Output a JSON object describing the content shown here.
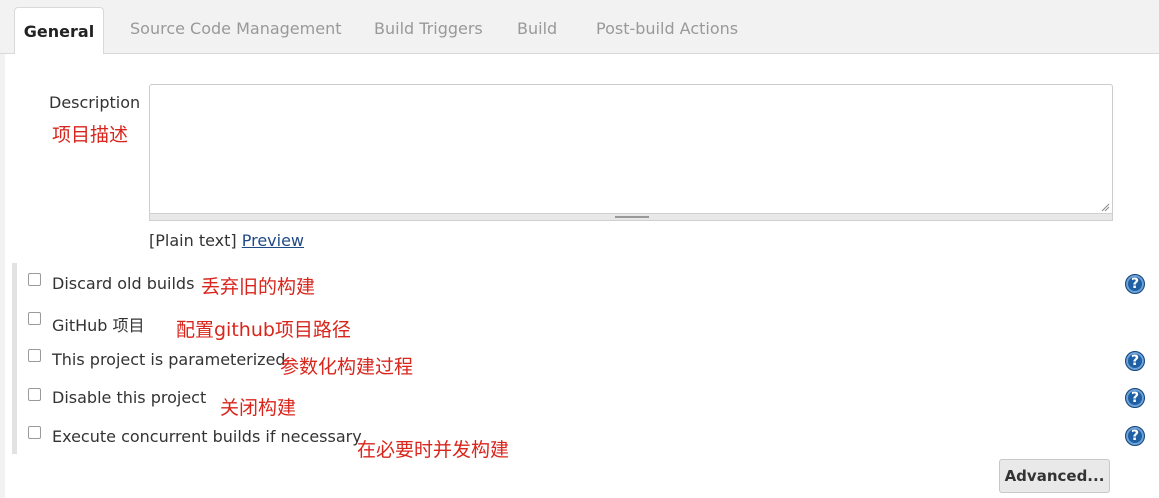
{
  "tabs": [
    {
      "label": "General",
      "active": true
    },
    {
      "label": "Source Code Management"
    },
    {
      "label": "Build Triggers"
    },
    {
      "label": "Build"
    },
    {
      "label": "Post-build Actions"
    }
  ],
  "description": {
    "label": "Description",
    "annotation": "项目描述",
    "value": "",
    "format_text": "[Plain text]",
    "preview_link": "Preview"
  },
  "options": [
    {
      "label": "Discard old builds",
      "annotation": "丢弃旧的构建",
      "checked": false,
      "help": true
    },
    {
      "label": "GitHub 项目",
      "annotation": "配置github项目路径",
      "checked": false,
      "help": false
    },
    {
      "label": "This project is parameterized",
      "annotation": "参数化构建过程",
      "checked": false,
      "help": true
    },
    {
      "label": "Disable this project",
      "annotation": "关闭构建",
      "checked": false,
      "help": true
    },
    {
      "label": "Execute concurrent builds if necessary",
      "annotation": "在必要时并发构建",
      "checked": false,
      "help": true
    }
  ],
  "help_glyph": "?",
  "advanced_button": "Advanced...",
  "colors": {
    "annotation": "#d9261c",
    "help_icon": "#1f5fa3",
    "link": "#204a87"
  }
}
